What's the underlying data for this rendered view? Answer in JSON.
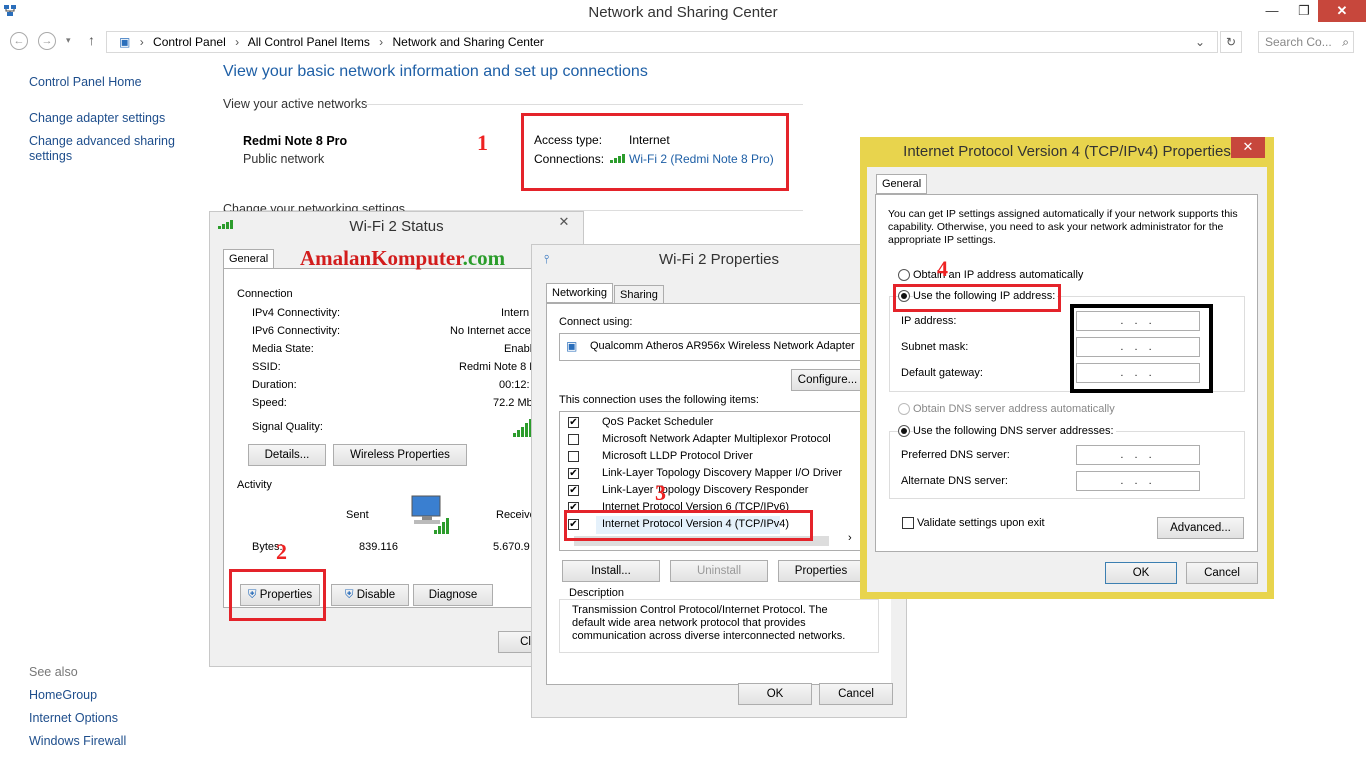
{
  "window": {
    "title": "Network and Sharing Center",
    "min": "—",
    "max": "❐",
    "close": "✕"
  },
  "address": {
    "crumbs": [
      "Control Panel",
      "All Control Panel Items",
      "Network and Sharing Center"
    ],
    "search_placeholder": "Search Co..."
  },
  "sidebar": {
    "home": "Control Panel Home",
    "adapter": "Change adapter settings",
    "advanced_1": "Change advanced sharing",
    "advanced_2": "settings",
    "see_also": "See also",
    "homegroup": "HomeGroup",
    "internet_options": "Internet Options",
    "firewall": "Windows Firewall"
  },
  "main": {
    "heading": "View your basic network information and set up connections",
    "active_networks": "View your active networks",
    "network_name": "Redmi Note 8 Pro",
    "network_type": "Public network",
    "access_type_label": "Access type:",
    "access_type_value": "Internet",
    "connections_label": "Connections:",
    "connections_value": "Wi-Fi 2 (Redmi Note 8 Pro)",
    "change_settings": "Change your networking settings"
  },
  "annotations": {
    "n1": "1",
    "n2": "2",
    "n3": "3",
    "n4": "4",
    "watermark_part1": "Amalan",
    "watermark_part2": "Komputer",
    "watermark_part3": ".com"
  },
  "status_dialog": {
    "title": "Wi-Fi 2 Status",
    "tab": "General",
    "connection": "Connection",
    "rows": [
      {
        "label": "IPv4 Connectivity:",
        "value": "Intern"
      },
      {
        "label": "IPv6 Connectivity:",
        "value": "No Internet acce"
      },
      {
        "label": "Media State:",
        "value": "Enabl"
      },
      {
        "label": "SSID:",
        "value": "Redmi Note 8 P"
      },
      {
        "label": "Duration:",
        "value": "00:12:"
      },
      {
        "label": "Speed:",
        "value": "72.2 Mb"
      }
    ],
    "signal_quality": "Signal Quality:",
    "details_btn": "Details...",
    "wireless_props_btn": "Wireless Properties",
    "activity": "Activity",
    "sent": "Sent",
    "received": "Receive",
    "bytes": "Bytes:",
    "bytes_sent": "839.116",
    "bytes_received": "5.670.9",
    "properties_btn": "Properties",
    "disable_btn": "Disable",
    "diagnose_btn": "Diagnose",
    "close_btn": "Cl"
  },
  "props_dialog": {
    "title": "Wi-Fi 2 Properties",
    "tab_networking": "Networking",
    "tab_sharing": "Sharing",
    "connect_using": "Connect using:",
    "adapter": "Qualcomm Atheros AR956x Wireless Network Adapter",
    "configure_btn": "Configure...",
    "items_label": "This connection uses the following items:",
    "items": [
      {
        "label": "QoS Packet Scheduler",
        "checked": "✔"
      },
      {
        "label": "Microsoft Network Adapter Multiplexor Protocol",
        "checked": ""
      },
      {
        "label": "Microsoft LLDP Protocol Driver",
        "checked": ""
      },
      {
        "label": "Link-Layer Topology Discovery Mapper I/O Driver",
        "checked": "✔"
      },
      {
        "label": "Link-Layer Topology Discovery Responder",
        "checked": "✔"
      },
      {
        "label": "Internet Protocol Version 6 (TCP/IPv6)",
        "checked": "✔"
      },
      {
        "label": "Internet Protocol Version 4 (TCP/IPv4)",
        "checked": "✔"
      }
    ],
    "install_btn": "Install...",
    "uninstall_btn": "Uninstall",
    "properties_btn": "Properties",
    "description_label": "Description",
    "description_text": "Transmission Control Protocol/Internet Protocol. The default wide area network protocol that provides communication across diverse interconnected networks.",
    "ok_btn": "OK",
    "cancel_btn": "Cancel"
  },
  "ipv4_dialog": {
    "title": "Internet Protocol Version 4 (TCP/IPv4) Properties",
    "tab": "General",
    "intro": "You can get IP settings assigned automatically if your network supports this capability. Otherwise, you need to ask your network administrator for the appropriate IP settings.",
    "obtain_ip": "Obtain an IP address automatically",
    "use_ip": "Use the following IP address:",
    "ip_address": "IP address:",
    "subnet_mask": "Subnet mask:",
    "default_gateway": "Default gateway:",
    "obtain_dns": "Obtain DNS server address automatically",
    "use_dns": "Use the following DNS server addresses:",
    "preferred_dns": "Preferred DNS server:",
    "alternate_dns": "Alternate DNS server:",
    "ip_empty": ". . .",
    "validate": "Validate settings upon exit",
    "advanced_btn": "Advanced...",
    "ok_btn": "OK",
    "cancel_btn": "Cancel"
  },
  "colors": {
    "accent_red": "#e4232a",
    "link_blue": "#1e5fa6",
    "ipv4_border": "#e8d44d"
  }
}
